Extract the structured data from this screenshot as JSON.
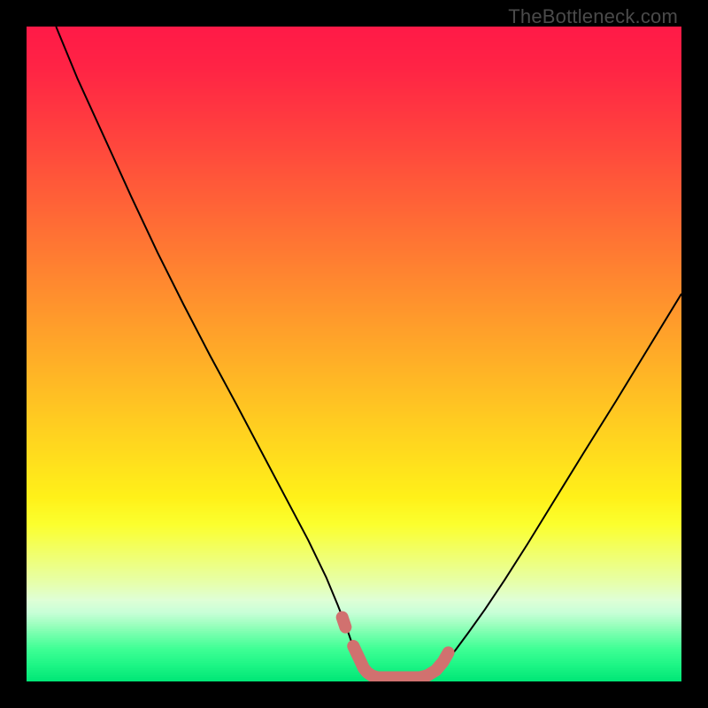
{
  "watermark": "TheBottleneck.com",
  "gradient": {
    "stops": [
      {
        "offset": 0.0,
        "color": "#ff1a47"
      },
      {
        "offset": 0.06,
        "color": "#ff2345"
      },
      {
        "offset": 0.12,
        "color": "#ff3441"
      },
      {
        "offset": 0.18,
        "color": "#ff463d"
      },
      {
        "offset": 0.24,
        "color": "#ff5939"
      },
      {
        "offset": 0.3,
        "color": "#ff6c35"
      },
      {
        "offset": 0.36,
        "color": "#ff7f31"
      },
      {
        "offset": 0.42,
        "color": "#ff922d"
      },
      {
        "offset": 0.48,
        "color": "#ffa529"
      },
      {
        "offset": 0.54,
        "color": "#ffb825"
      },
      {
        "offset": 0.6,
        "color": "#ffcb21"
      },
      {
        "offset": 0.66,
        "color": "#ffde1d"
      },
      {
        "offset": 0.72,
        "color": "#fff119"
      },
      {
        "offset": 0.76,
        "color": "#fbff2e"
      },
      {
        "offset": 0.79,
        "color": "#f4ff58"
      },
      {
        "offset": 0.82,
        "color": "#edff82"
      },
      {
        "offset": 0.85,
        "color": "#e6ffac"
      },
      {
        "offset": 0.875,
        "color": "#dfffd6"
      },
      {
        "offset": 0.895,
        "color": "#c7ffd7"
      },
      {
        "offset": 0.912,
        "color": "#9fffc0"
      },
      {
        "offset": 0.93,
        "color": "#6fffaa"
      },
      {
        "offset": 0.95,
        "color": "#3fff95"
      },
      {
        "offset": 0.975,
        "color": "#1df585"
      },
      {
        "offset": 1.0,
        "color": "#00e676"
      }
    ]
  },
  "chart_data": {
    "type": "line",
    "title": "",
    "xlabel": "",
    "ylabel": "",
    "xlim": [
      0,
      1
    ],
    "ylim": [
      0,
      1
    ],
    "series": [
      {
        "name": "left-curve",
        "color": "#000000",
        "width": 2,
        "points": [
          {
            "x": 0.045,
            "y": 1.0
          },
          {
            "x": 0.078,
            "y": 0.92
          },
          {
            "x": 0.12,
            "y": 0.828
          },
          {
            "x": 0.16,
            "y": 0.74
          },
          {
            "x": 0.2,
            "y": 0.655
          },
          {
            "x": 0.24,
            "y": 0.575
          },
          {
            "x": 0.28,
            "y": 0.498
          },
          {
            "x": 0.32,
            "y": 0.424
          },
          {
            "x": 0.358,
            "y": 0.352
          },
          {
            "x": 0.395,
            "y": 0.282
          },
          {
            "x": 0.43,
            "y": 0.216
          },
          {
            "x": 0.458,
            "y": 0.158
          },
          {
            "x": 0.475,
            "y": 0.117
          },
          {
            "x": 0.488,
            "y": 0.084
          },
          {
            "x": 0.498,
            "y": 0.055
          },
          {
            "x": 0.505,
            "y": 0.036
          },
          {
            "x": 0.512,
            "y": 0.022
          },
          {
            "x": 0.52,
            "y": 0.012
          },
          {
            "x": 0.53,
            "y": 0.006
          }
        ]
      },
      {
        "name": "right-curve",
        "color": "#000000",
        "width": 2,
        "points": [
          {
            "x": 0.61,
            "y": 0.006
          },
          {
            "x": 0.618,
            "y": 0.01
          },
          {
            "x": 0.628,
            "y": 0.018
          },
          {
            "x": 0.64,
            "y": 0.03
          },
          {
            "x": 0.655,
            "y": 0.048
          },
          {
            "x": 0.675,
            "y": 0.075
          },
          {
            "x": 0.7,
            "y": 0.11
          },
          {
            "x": 0.73,
            "y": 0.155
          },
          {
            "x": 0.765,
            "y": 0.21
          },
          {
            "x": 0.805,
            "y": 0.275
          },
          {
            "x": 0.85,
            "y": 0.348
          },
          {
            "x": 0.9,
            "y": 0.428
          },
          {
            "x": 0.95,
            "y": 0.51
          },
          {
            "x": 1.0,
            "y": 0.592
          }
        ]
      },
      {
        "name": "bottom-segment",
        "color": "#d1716f",
        "width": 14,
        "linecap": "round",
        "points": [
          {
            "x": 0.499,
            "y": 0.054
          },
          {
            "x": 0.515,
            "y": 0.02
          },
          {
            "x": 0.52,
            "y": 0.014
          },
          {
            "x": 0.527,
            "y": 0.009
          },
          {
            "x": 0.536,
            "y": 0.006
          },
          {
            "x": 0.6,
            "y": 0.006
          },
          {
            "x": 0.612,
            "y": 0.009
          },
          {
            "x": 0.625,
            "y": 0.017
          },
          {
            "x": 0.636,
            "y": 0.03
          },
          {
            "x": 0.644,
            "y": 0.044
          }
        ]
      },
      {
        "name": "bottom-dot",
        "color": "#d1716f",
        "width": 14,
        "linecap": "round",
        "points": [
          {
            "x": 0.482,
            "y": 0.098
          },
          {
            "x": 0.487,
            "y": 0.083
          }
        ]
      }
    ]
  }
}
